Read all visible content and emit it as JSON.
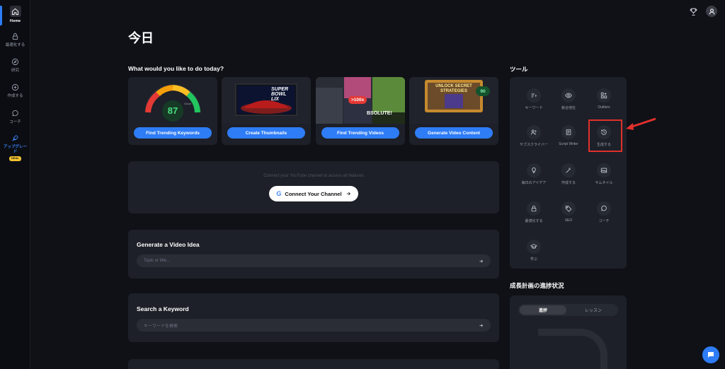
{
  "sidebar": {
    "items": [
      {
        "label": "Home",
        "icon": "home-icon"
      },
      {
        "label": "最適化する",
        "icon": "lock-icon"
      },
      {
        "label": "研究",
        "icon": "compass-icon"
      },
      {
        "label": "作成する",
        "icon": "plus-circle-icon"
      },
      {
        "label": "コーチ",
        "icon": "chat-icon"
      },
      {
        "label": "アップグレード",
        "icon": "rocket-icon"
      }
    ],
    "new_badge": "DEAL"
  },
  "page": {
    "title": "今日"
  },
  "today": {
    "heading": "What would you like to do today?",
    "cards": [
      {
        "button": "Find Trending Keywords",
        "gauge_value": "87",
        "gauge_label": "Good"
      },
      {
        "button": "Create Thumbnails",
        "thumb_text": "SUPER BOWL LIX"
      },
      {
        "button": "Find Trending Videos",
        "badge": ">100x",
        "thumb_text": "BSOLUTE!"
      },
      {
        "button": "Generate Video Content",
        "thumb_text": "UNLOCK SECRET STRATEGIES",
        "score": "90"
      }
    ]
  },
  "connect": {
    "text": "Connect your YouTube channel to access all features",
    "button": "Connect Your Channel",
    "google_letter": "G"
  },
  "video_idea": {
    "title": "Generate a Video Idea",
    "placeholder": "Topic or title..."
  },
  "keyword": {
    "title": "Search a Keyword",
    "placeholder": "キーワードを検索"
  },
  "tools": {
    "heading": "ツール",
    "items": [
      {
        "label": "キーワード",
        "icon": "keyword-icon"
      },
      {
        "label": "競合他社",
        "icon": "eye-icon"
      },
      {
        "label": "Outliers",
        "icon": "outliers-icon"
      },
      {
        "label": "サブスクライバー",
        "icon": "subscribers-icon"
      },
      {
        "label": "Script Writer",
        "icon": "script-icon"
      },
      {
        "label": "生成する",
        "icon": "history-icon"
      },
      {
        "label": "毎日のアイデア",
        "icon": "lightbulb-icon"
      },
      {
        "label": "作成する",
        "icon": "magic-wand-icon"
      },
      {
        "label": "サムネイル",
        "icon": "image-icon"
      },
      {
        "label": "最適化する",
        "icon": "lock-icon"
      },
      {
        "label": "SEO",
        "icon": "tag-icon"
      },
      {
        "label": "コーチ",
        "icon": "chat-icon"
      },
      {
        "label": "学ぶ",
        "icon": "graduation-cap-icon"
      }
    ]
  },
  "growth": {
    "heading": "成長計画の進捗状況",
    "tab_progress": "進捗",
    "tab_lessons": "レッスン"
  },
  "colors": {
    "accent": "#2e7cf6",
    "highlight": "#e0302c",
    "panel": "#1d2028",
    "background": "#0f1117"
  }
}
